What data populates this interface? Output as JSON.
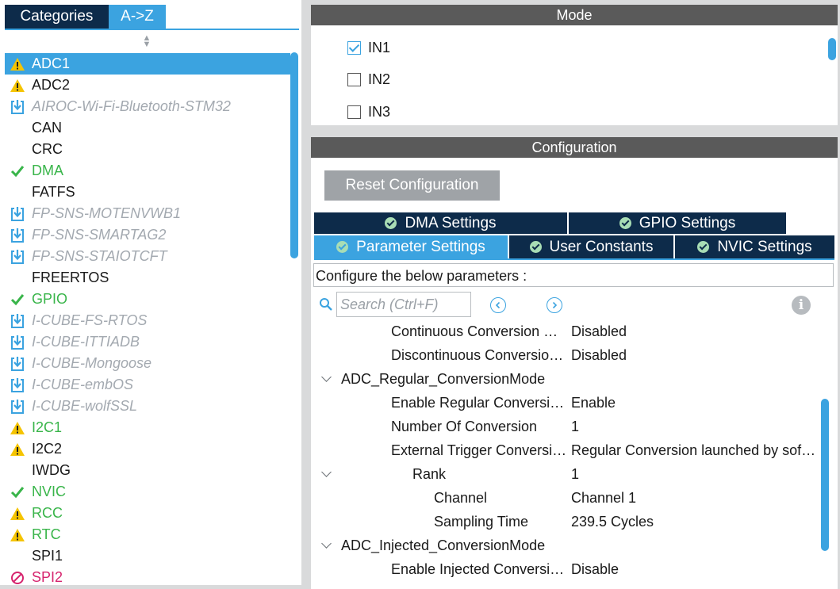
{
  "left_panel": {
    "tabs": [
      {
        "label": "Categories",
        "active": false
      },
      {
        "label": "A->Z",
        "active": true
      }
    ],
    "components": [
      {
        "label": "ADC1",
        "status": "warning",
        "selected": true
      },
      {
        "label": "ADC2",
        "status": "warning"
      },
      {
        "label": "AIROC-Wi-Fi-Bluetooth-STM32",
        "status": "pack"
      },
      {
        "label": "CAN",
        "status": "none"
      },
      {
        "label": "CRC",
        "status": "none"
      },
      {
        "label": "DMA",
        "status": "ok"
      },
      {
        "label": "FATFS",
        "status": "none"
      },
      {
        "label": "FP-SNS-MOTENVWB1",
        "status": "pack"
      },
      {
        "label": "FP-SNS-SMARTAG2",
        "status": "pack"
      },
      {
        "label": "FP-SNS-STAIOTCFT",
        "status": "pack"
      },
      {
        "label": "FREERTOS",
        "status": "none"
      },
      {
        "label": "GPIO",
        "status": "ok"
      },
      {
        "label": "I-CUBE-FS-RTOS",
        "status": "pack"
      },
      {
        "label": "I-CUBE-ITTIADB",
        "status": "pack"
      },
      {
        "label": "I-CUBE-Mongoose",
        "status": "pack"
      },
      {
        "label": "I-CUBE-embOS",
        "status": "pack"
      },
      {
        "label": "I-CUBE-wolfSSL",
        "status": "pack"
      },
      {
        "label": "I2C1",
        "status": "warning-green"
      },
      {
        "label": "I2C2",
        "status": "warning"
      },
      {
        "label": "IWDG",
        "status": "none"
      },
      {
        "label": "NVIC",
        "status": "ok"
      },
      {
        "label": "RCC",
        "status": "warning-green"
      },
      {
        "label": "RTC",
        "status": "warning-green"
      },
      {
        "label": "SPI1",
        "status": "none"
      },
      {
        "label": "SPI2",
        "status": "error"
      }
    ]
  },
  "mode": {
    "title": "Mode",
    "items": [
      {
        "label": "IN1",
        "checked": true
      },
      {
        "label": "IN2",
        "checked": false
      },
      {
        "label": "IN3",
        "checked": false
      }
    ]
  },
  "configuration": {
    "title": "Configuration",
    "reset_label": "Reset Configuration",
    "tabs_row1": [
      "DMA Settings",
      "GPIO Settings"
    ],
    "tabs_row2": [
      "Parameter Settings",
      "User Constants",
      "NVIC Settings"
    ],
    "active_tab": "Parameter Settings",
    "description": "Configure the below parameters :",
    "search_placeholder": "Search (Ctrl+F)",
    "params": [
      {
        "name": "Continuous Conversion Mode",
        "value": "Disabled",
        "level": 1
      },
      {
        "name": "Discontinuous Conversion Mode",
        "value": "Disabled",
        "level": 1
      },
      {
        "name": "ADC_Regular_ConversionMode",
        "value": "",
        "level": 0,
        "group": true
      },
      {
        "name": "Enable Regular Conversions",
        "value": "Enable",
        "level": 1
      },
      {
        "name": "Number Of Conversion",
        "value": "1",
        "level": 1
      },
      {
        "name": "External Trigger Conversion Source",
        "value": "Regular Conversion launched by software",
        "level": 1
      },
      {
        "name": "Rank",
        "value": "1",
        "level": 2,
        "group": true
      },
      {
        "name": "Channel",
        "value": "Channel 1",
        "level": 3
      },
      {
        "name": "Sampling Time",
        "value": "239.5 Cycles",
        "level": 3
      },
      {
        "name": "ADC_Injected_ConversionMode",
        "value": "",
        "level": 0,
        "group": true
      },
      {
        "name": "Enable Injected Conversions",
        "value": "Disable",
        "level": 1
      }
    ]
  },
  "colors": {
    "accent": "#3ba3e0",
    "navy": "#0d2b4a",
    "ok": "#39b54a",
    "warning": "#f5c400",
    "error": "#d6246e",
    "pack": "#a3a9b0"
  }
}
